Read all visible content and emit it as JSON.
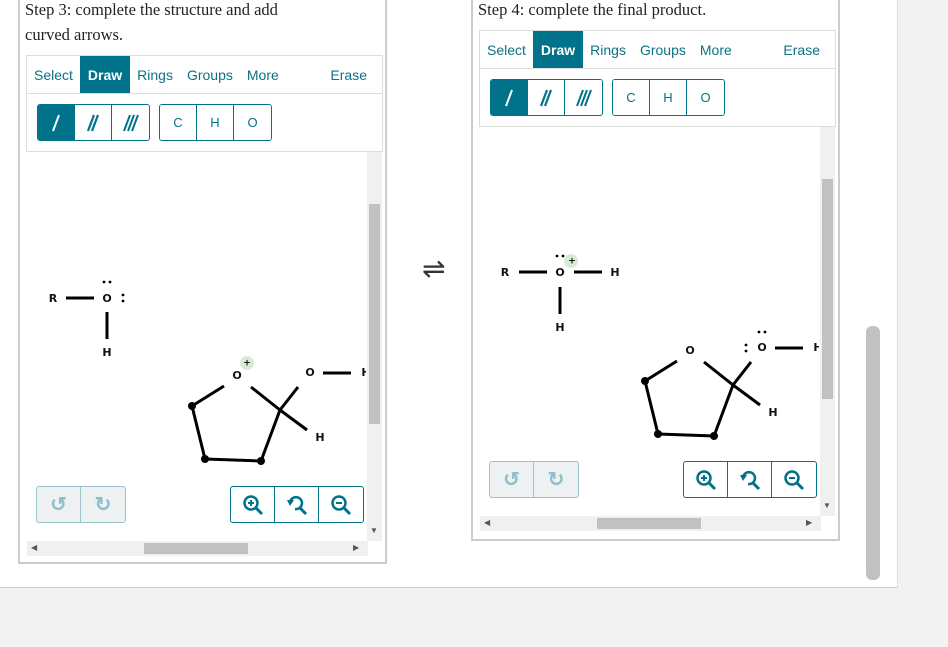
{
  "step3": {
    "title": "Step 3: complete the structure and add curved arrows.",
    "tabs": [
      "Select",
      "Draw",
      "Rings",
      "Groups",
      "More"
    ],
    "erase": "Erase",
    "active_tab": "Draw",
    "bond_tools": [
      "single-bond",
      "double-bond",
      "triple-bond"
    ],
    "atoms": [
      "C",
      "H",
      "O"
    ],
    "molecule": {
      "a": "R",
      "b": "O",
      "c": "H",
      "ring_o": "O",
      "charge": "+",
      "oh_o": "O",
      "oh_h": "H",
      "ch_h": "H"
    }
  },
  "step4": {
    "title": "Step 4: complete the final product.",
    "tabs": [
      "Select",
      "Draw",
      "Rings",
      "Groups",
      "More"
    ],
    "erase": "Erase",
    "active_tab": "Draw",
    "bond_tools": [
      "single-bond",
      "double-bond",
      "triple-bond"
    ],
    "atoms": [
      "C",
      "H",
      "O"
    ],
    "molecule": {
      "a": "R",
      "b": "O",
      "c": "H",
      "d": "H",
      "charge": "+",
      "ring_o": "O",
      "oh_o": "O",
      "oh_h": "H",
      "ch_h": "H"
    }
  },
  "equilibrium_symbol": "⇌",
  "colors": {
    "accent": "#00738a",
    "charge_bg": "#d4edd4"
  }
}
